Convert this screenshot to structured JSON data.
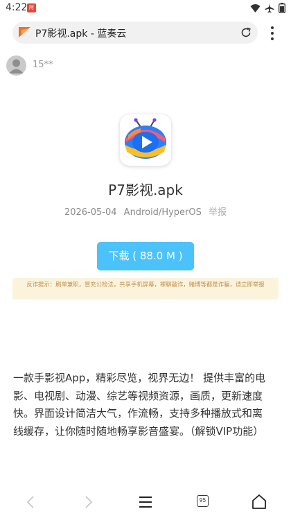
{
  "status_bar": {
    "time": "4:22",
    "app_badge": "阿里"
  },
  "browser": {
    "page_title": "P7影视.apk - 蓝奏云"
  },
  "user": {
    "name": "15**"
  },
  "app": {
    "name": "P7影视.apk",
    "date": "2026-05-04",
    "platform": "Android/HyperOS",
    "report_label": "举报",
    "download_label": "下载 ( 88.0 M )",
    "warning": "反诈提示：刷单兼职，冒充公检法，共享手机屏幕，裸聊敲诈，赌博等都是诈骗，请立即举报",
    "description": "一款手影视App，精彩尽览，视界无边！ 提供丰富的电影、电视剧、动漫、综艺等视频资源，画质，更新速度快。界面设计简洁大气，作流畅，支持多种播放式和离线缓存，让你随时随地畅享影音盛宴。（解锁VIP功能）"
  },
  "bottom_nav": {
    "tab_count": "95"
  },
  "icons": {
    "status": [
      "wifi-icon",
      "airplane-icon",
      "battery-icon"
    ],
    "nav": [
      "back-icon",
      "forward-icon",
      "menu-lines-icon",
      "tabs-icon",
      "home-icon"
    ]
  },
  "colors": {
    "download_button": "#4cc2fb",
    "warning_bg": "#fbf3dc",
    "warning_text": "#c08f4e"
  }
}
